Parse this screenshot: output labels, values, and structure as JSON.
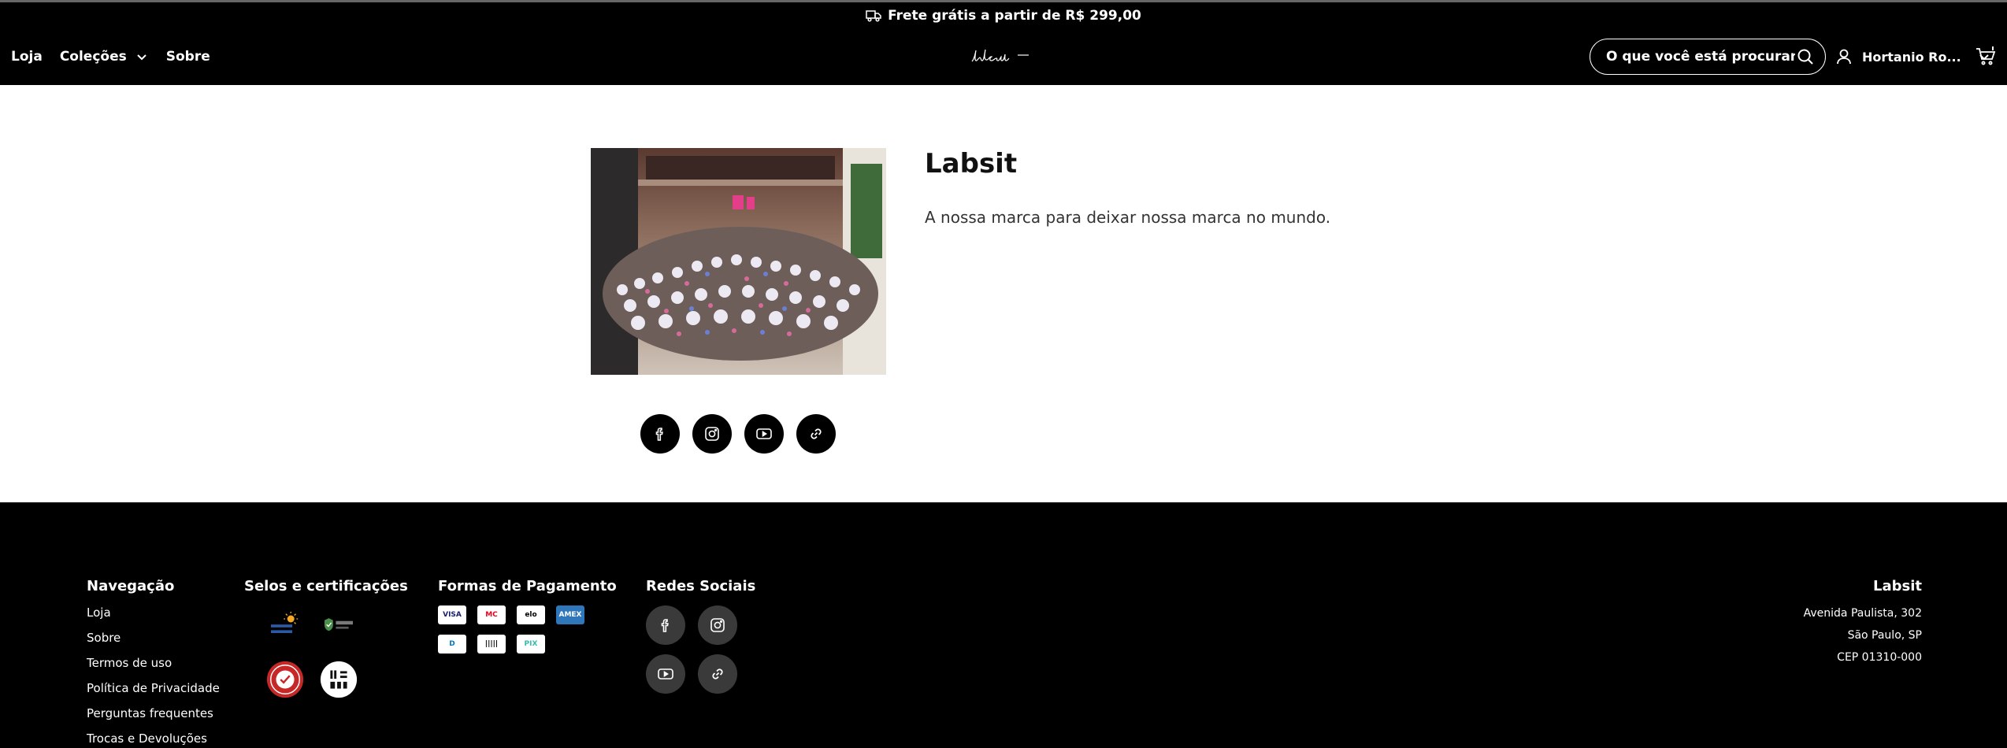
{
  "announcement": {
    "text": "Frete grátis a partir de R$ 299,00"
  },
  "header": {
    "nav": [
      {
        "label": "Loja"
      },
      {
        "label": "Coleções"
      },
      {
        "label": "Sobre"
      }
    ],
    "logo_text": "labsit",
    "search_placeholder": "O que você está procurando?",
    "user_name": "Hortanio Ro..."
  },
  "about": {
    "title": "Labsit",
    "description": "A nossa marca para deixar nossa marca no mundo.",
    "socials": [
      "facebook-icon",
      "instagram-icon",
      "youtube-icon",
      "link-icon"
    ]
  },
  "footer": {
    "nav_title": "Navegação",
    "nav_items": [
      {
        "label": "Loja"
      },
      {
        "label": "Sobre"
      },
      {
        "label": "Termos de uso"
      },
      {
        "label": "Política de Privacidade"
      },
      {
        "label": "Perguntas frequentes"
      },
      {
        "label": "Trocas e Devoluções"
      }
    ],
    "seals_title": "Selos e certificações",
    "pay_title": "Formas de Pagamento",
    "pay_cards": [
      {
        "label": "VISA",
        "color": "#1a1f71"
      },
      {
        "label": "MC",
        "color": "#eb001b"
      },
      {
        "label": "elo",
        "color": "#000000"
      },
      {
        "label": "AMEX",
        "color": "#2e77bb"
      },
      {
        "label": "D",
        "color": "#0079be"
      },
      {
        "label": "|||||",
        "color": "#000000"
      },
      {
        "label": "PIX",
        "color": "#32bcad"
      }
    ],
    "social_title": "Redes Sociais",
    "address_title": "Labsit",
    "address_lines": [
      "Avenida Paulista, 302",
      "São Paulo, SP",
      "CEP 01310-000"
    ]
  }
}
